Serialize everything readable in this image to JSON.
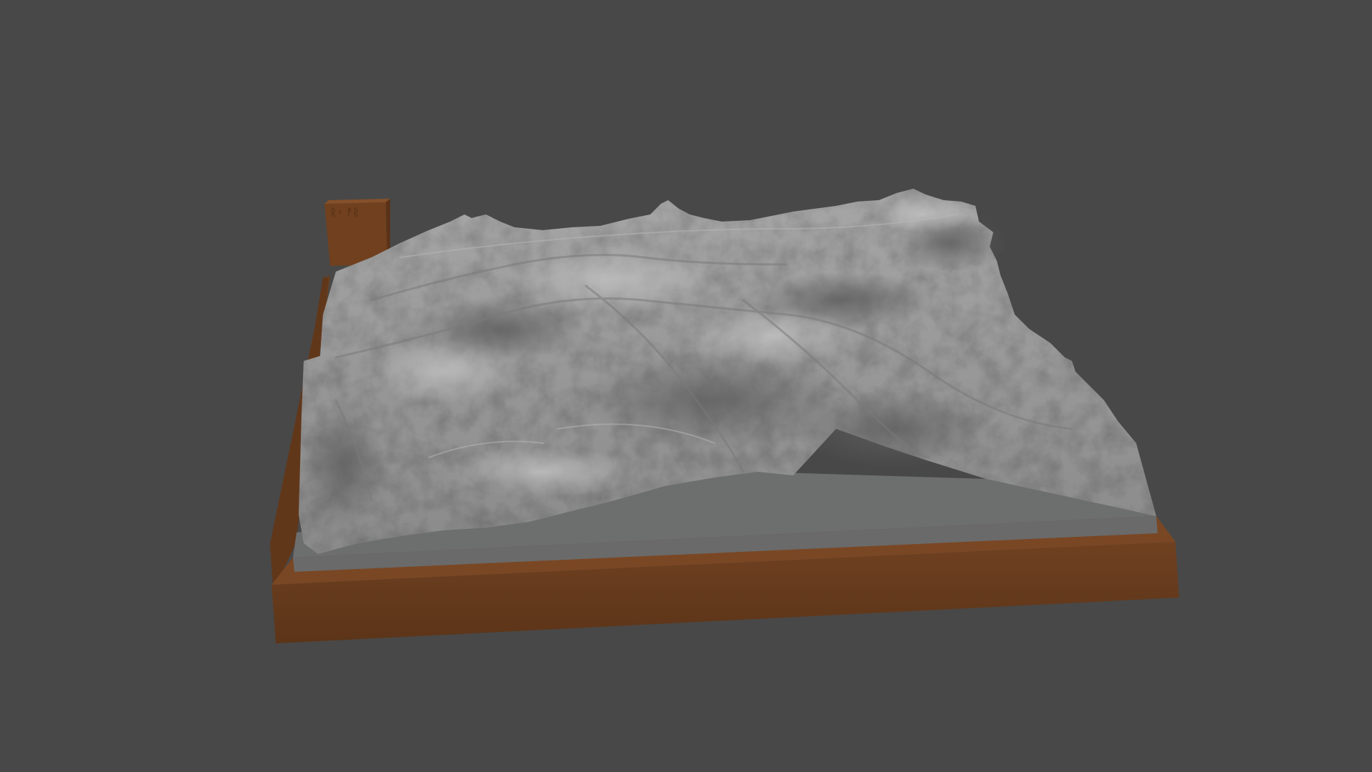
{
  "viewport": {
    "background_color": "#484848"
  },
  "model": {
    "base_color": "#6b3f1f",
    "base_shadow_color": "#4f2d15",
    "terrain_color": "#9c9c9c",
    "terrain_flat_color": "#6e6f6f",
    "label_block_color": "#7a4423",
    "label_block_glyphs": "ᚱᚲ ᚠᚱ"
  }
}
